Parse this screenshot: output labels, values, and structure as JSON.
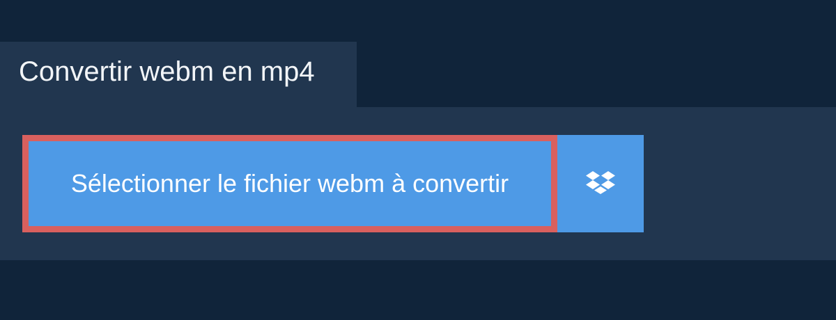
{
  "tab": {
    "title": "Convertir webm en mp4"
  },
  "upload": {
    "select_label": "Sélectionner le fichier webm à convertir",
    "dropbox_icon": "dropbox-icon"
  },
  "colors": {
    "background": "#10243a",
    "panel": "#21364f",
    "button": "#4e9ae6",
    "button_highlight_border": "#d9605e",
    "text": "#ffffff"
  }
}
